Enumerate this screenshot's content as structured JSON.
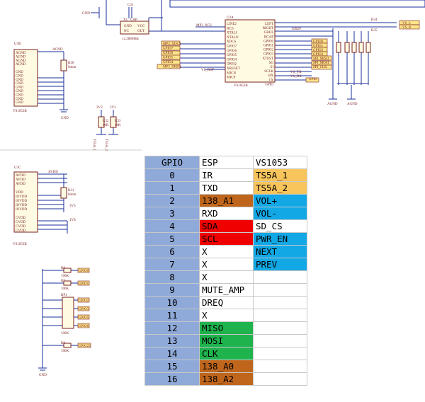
{
  "schematic": {
    "texts": {
      "gnd_top": "GND",
      "cap_c31": "C31",
      "cap_label": "CAP",
      "x1": "X1",
      "gnd_x": "GND",
      "nc": "NC",
      "out": "OUT",
      "vcc": "VCC",
      "xtal_freq": "12.288MHz",
      "mp3_xcs": "MP3_XCS",
      "u3a": "U3A",
      "u3a_part": "VS1053B",
      "u3b": "U3B",
      "u3b_part": "VS1053B",
      "u3c": "U3C",
      "u3c_part": "VS1053B",
      "agnd": "AGND",
      "gnd_mid": "GND",
      "gnd_bottom": "GND",
      "avdd": "AVDD",
      "gnd_left": "GND",
      "r30": "R30",
      "r30_val": "0ohm",
      "r31": "R31",
      "r31_val": "0ohm",
      "v3": "3V3",
      "v18": "1V8",
      "r32": "R32",
      "r33": "R33",
      "k10": "10K",
      "ts5a1": "TS5A_1",
      "ts5a2": "TS5A_2",
      "r34": "R34",
      "r35": "R35",
      "vs_l": "VS_L",
      "vs_r": "VS_R",
      "gbuf": "GBUF",
      "rp1": "RP1",
      "r6": "R6",
      "r7": "R7",
      "r8": "R8",
      "k100": "100K",
      "mp3_rst": "MP3_RST",
      "sclk": "SCLK",
      "so": "SO",
      "si": "SI",
      "rx": "RX",
      "tx": "TX",
      "gpio": "GPIO",
      "spi_miso": "SPI_MISO",
      "spi_mosi": "SPI_MOSI",
      "spi_clk": "SPI_CLK",
      "vs_tx": "VS_TX",
      "vs_rx": "VS_RX",
      "vs_rst": "VS_RST"
    },
    "u3a_left_pins": [
      "LINE2",
      "XCS",
      "XTALI",
      "XTALO",
      "XDCS",
      "GPIO7",
      "GPIO6",
      "GPIO5",
      "GPIO4",
      "DREQ",
      "XRESET",
      "MICN",
      "MICP"
    ],
    "u3a_right_pins": [
      "LEFT",
      "RIGHT",
      "GBUF",
      "RCAP",
      "GPIO0",
      "GPIO1",
      "GPIO2",
      "GPIO3",
      "XTEST",
      "SO",
      "SI",
      "SCLK",
      "RX",
      "TX",
      "GPIO"
    ],
    "u3a_left_nets": [
      "MP3_XDCS",
      "GPIO7",
      "GPIO6",
      "GPIO5",
      "GPIO4",
      "MP3_DREQ"
    ],
    "u3a_right_nets": [
      "GPIO0",
      "GPIO1",
      "GPIO2",
      "GPIO3"
    ],
    "u3b_pins": [
      "AGND",
      "AGND",
      "AGND",
      "AGND",
      "",
      "GND",
      "GND",
      "GND",
      "GND",
      "GND",
      "GND",
      "GND",
      "GND",
      "GND"
    ],
    "u3c_pins": [
      "AVDD",
      "AVDD",
      "AVDD",
      "",
      "VDD",
      "IOVDD",
      "IOVDD",
      "IOVDD",
      "IOVDD",
      "",
      "CVDD",
      "CVDD",
      "CVDD",
      "CVDD"
    ],
    "gpio_nets": [
      "GPIO0",
      "GPIO1",
      "GPIO2",
      "GPIO3",
      "GPIO5",
      "GPIO6",
      "GPIO25"
    ]
  },
  "table": {
    "headers": [
      "GPIO",
      "ESP",
      "VS1053"
    ],
    "rows": [
      {
        "gpio": "0",
        "esp": "IR",
        "esp_color": "#ffffff",
        "vs": "TS5A_1",
        "vs_color": "#f7c55c"
      },
      {
        "gpio": "1",
        "esp": "TXD",
        "esp_color": "#ffffff",
        "vs": "TS5A_2",
        "vs_color": "#f7c55c"
      },
      {
        "gpio": "2",
        "esp": "138_A1",
        "esp_color": "#c0661c",
        "vs": "VOL+",
        "vs_color": "#12a8e6"
      },
      {
        "gpio": "3",
        "esp": "RXD",
        "esp_color": "#ffffff",
        "vs": "VOL-",
        "vs_color": "#12a8e6"
      },
      {
        "gpio": "4",
        "esp": "SDA",
        "esp_color": "#f00000",
        "vs": "SD_CS",
        "vs_color": "#ffffff"
      },
      {
        "gpio": "5",
        "esp": "SCL",
        "esp_color": "#f00000",
        "vs": "PWR_EN",
        "vs_color": "#12a8e6"
      },
      {
        "gpio": "6",
        "esp": "X",
        "esp_color": "#ffffff",
        "vs": "NEXT",
        "vs_color": "#12a8e6"
      },
      {
        "gpio": "7",
        "esp": "X",
        "esp_color": "#ffffff",
        "vs": "PREV",
        "vs_color": "#12a8e6"
      },
      {
        "gpio": "8",
        "esp": "X",
        "esp_color": "#ffffff",
        "vs": "",
        "vs_color": "#ffffff"
      },
      {
        "gpio": "9",
        "esp": "MUTE_AMP",
        "esp_color": "#ffffff",
        "vs": "",
        "vs_color": "#ffffff"
      },
      {
        "gpio": "10",
        "esp": "DREQ",
        "esp_color": "#ffffff",
        "vs": "",
        "vs_color": "#ffffff"
      },
      {
        "gpio": "11",
        "esp": "X",
        "esp_color": "#ffffff",
        "vs": "",
        "vs_color": "#ffffff"
      },
      {
        "gpio": "12",
        "esp": "MISO",
        "esp_color": "#1fb34d",
        "vs": "",
        "vs_color": "#ffffff"
      },
      {
        "gpio": "13",
        "esp": "MOSI",
        "esp_color": "#1fb34d",
        "vs": "",
        "vs_color": "#ffffff"
      },
      {
        "gpio": "14",
        "esp": "CLK",
        "esp_color": "#1fb34d",
        "vs": "",
        "vs_color": "#ffffff"
      },
      {
        "gpio": "15",
        "esp": "138_A0",
        "esp_color": "#c0661c",
        "vs": "",
        "vs_color": "#ffffff"
      },
      {
        "gpio": "16",
        "esp": "138_A2",
        "esp_color": "#c0661c",
        "vs": "",
        "vs_color": "#ffffff"
      }
    ]
  }
}
